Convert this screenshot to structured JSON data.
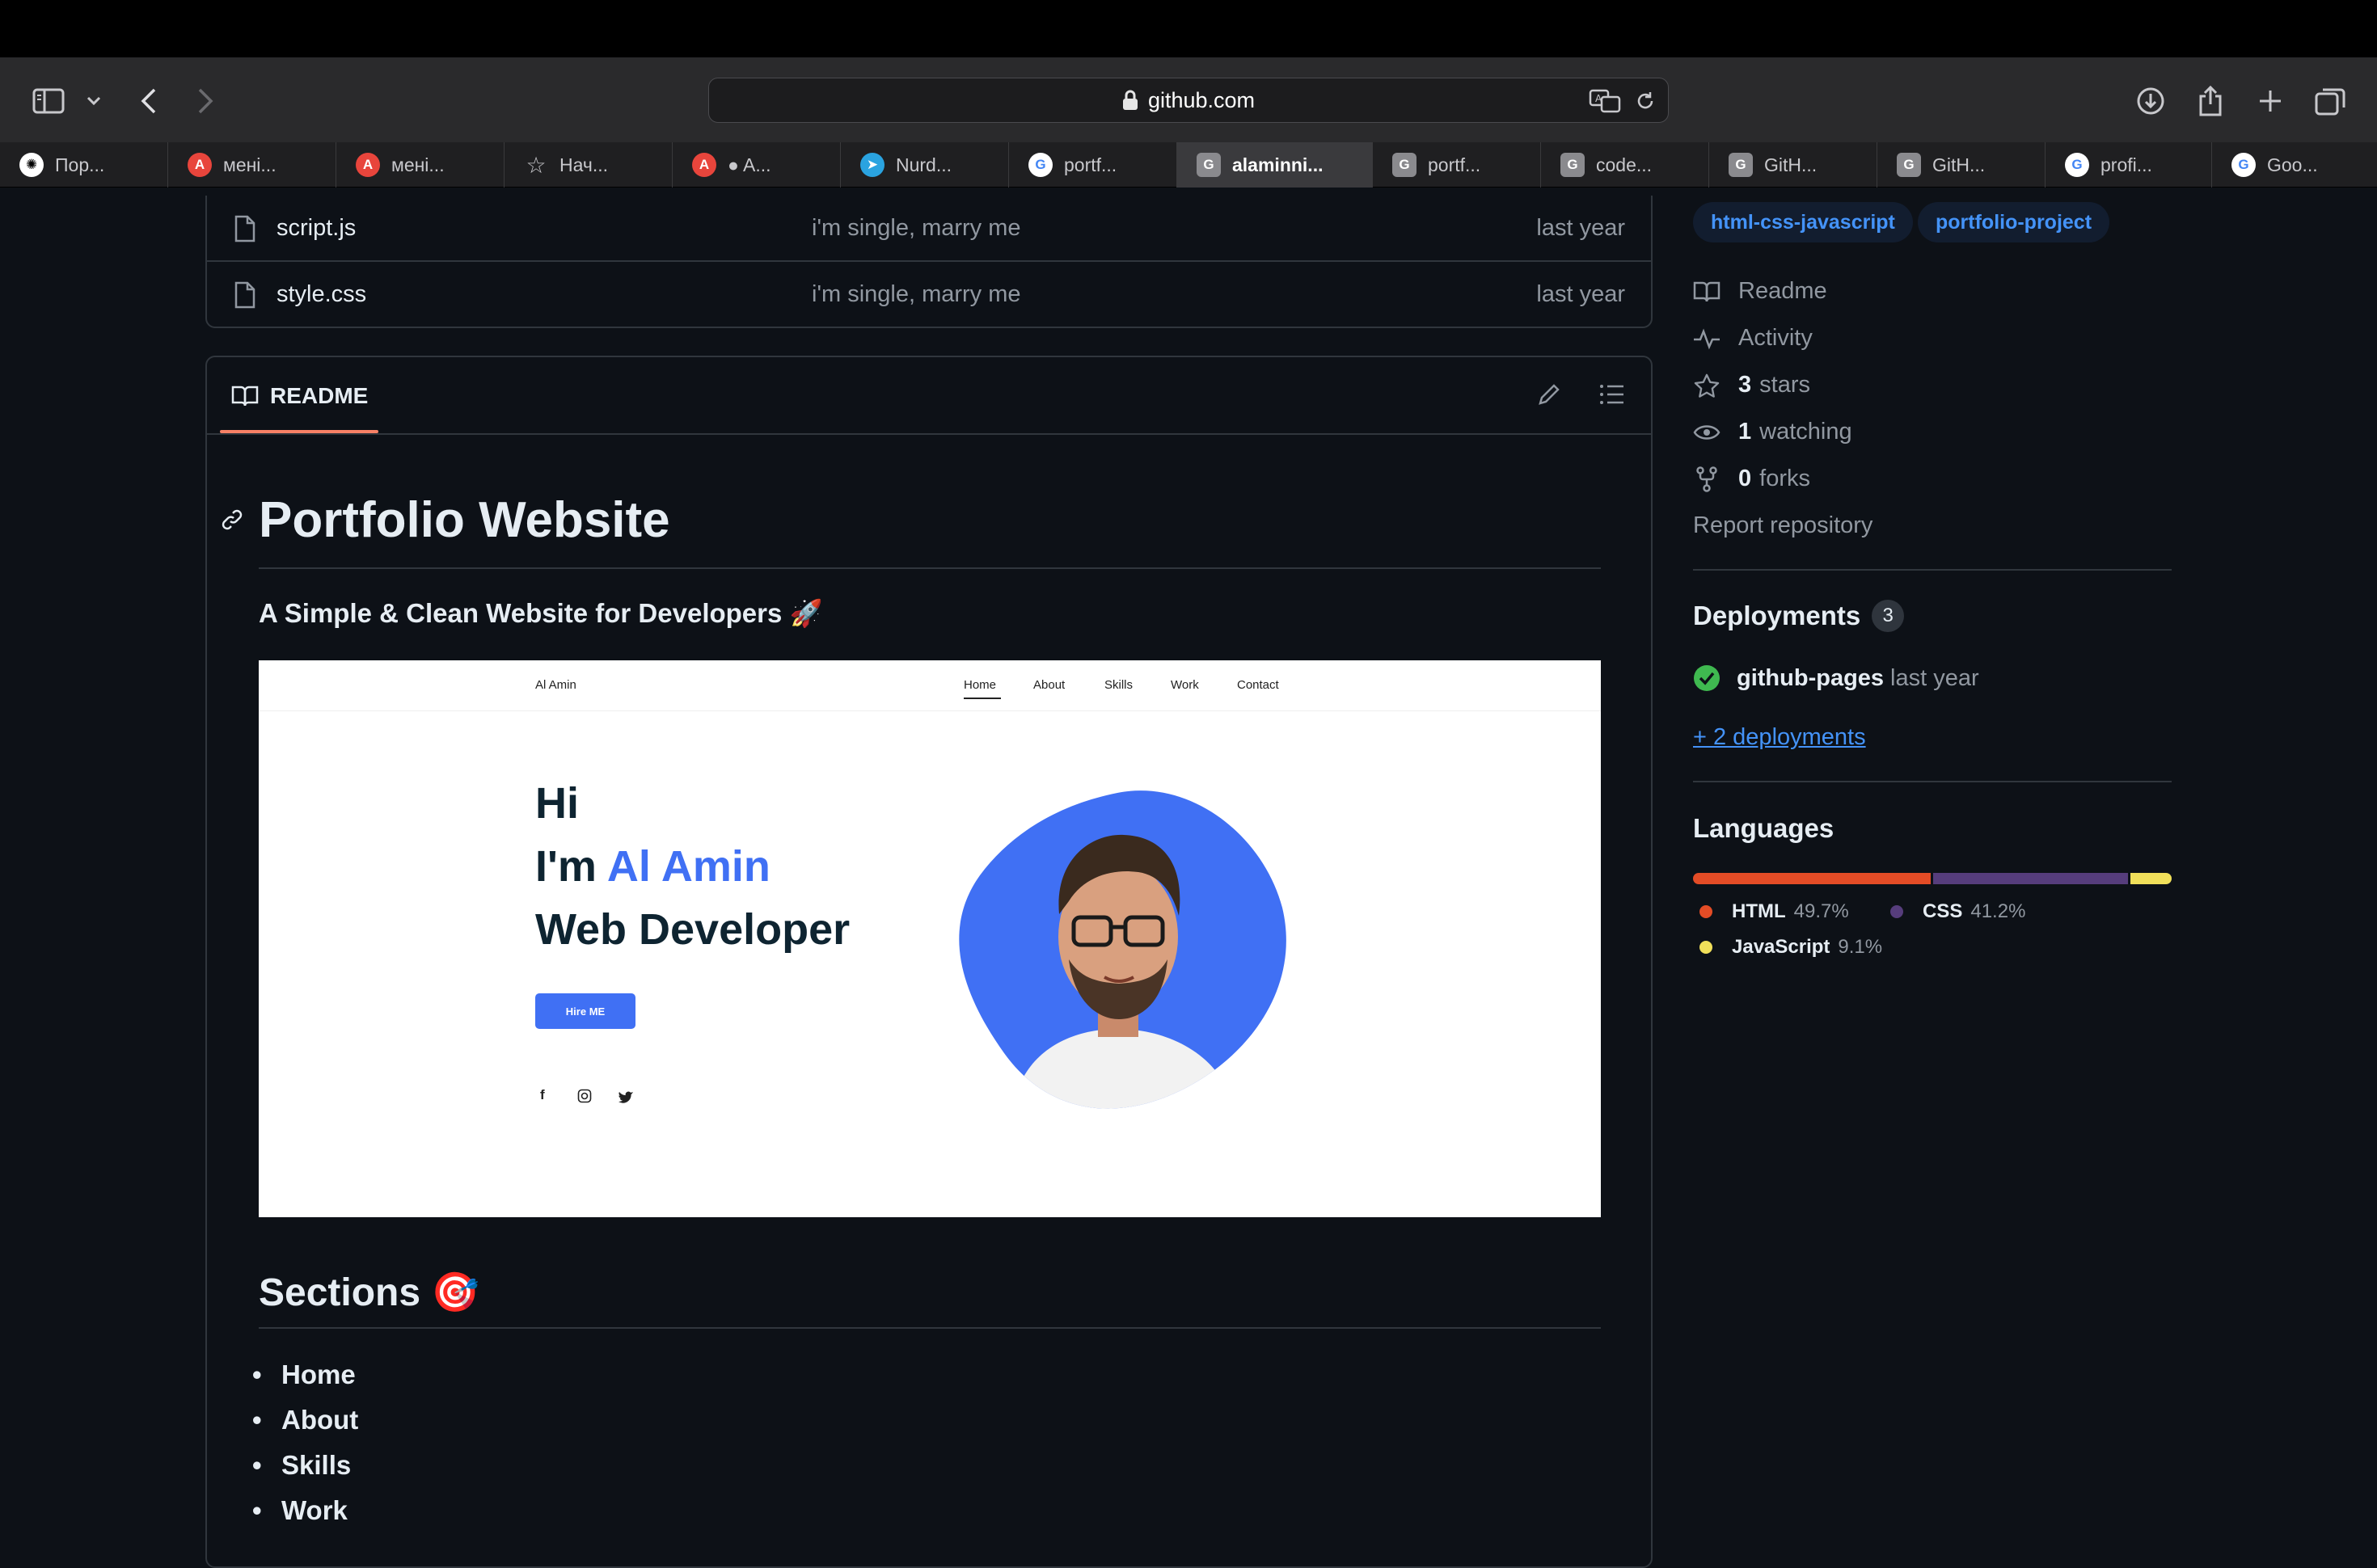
{
  "browser": {
    "url": "github.com",
    "tabs": [
      {
        "label": "Пор...",
        "icon": "openai-icon"
      },
      {
        "label": "мені...",
        "icon": "app-icon"
      },
      {
        "label": "мені...",
        "icon": "app-icon"
      },
      {
        "label": "Нач...",
        "icon": "star-icon"
      },
      {
        "label": "● A...",
        "icon": "app-icon"
      },
      {
        "label": "Nurd...",
        "icon": "telegram-icon"
      },
      {
        "label": "portf...",
        "icon": "google-icon"
      },
      {
        "label": "alaminni...",
        "icon": "g-icon",
        "active": true
      },
      {
        "label": "portf...",
        "icon": "g-icon"
      },
      {
        "label": "code...",
        "icon": "g-icon"
      },
      {
        "label": "GitH...",
        "icon": "g-icon"
      },
      {
        "label": "GitH...",
        "icon": "g-icon"
      },
      {
        "label": "profi...",
        "icon": "google-icon"
      },
      {
        "label": "Goo...",
        "icon": "google-icon"
      }
    ]
  },
  "files": [
    {
      "name": "script.js",
      "message": "i'm single, marry me",
      "date": "last year"
    },
    {
      "name": "style.css",
      "message": "i'm single, marry me",
      "date": "last year"
    }
  ],
  "readme": {
    "tab_label": "README",
    "title": "Portfolio Website",
    "subtitle": "A Simple & Clean Website for Developers 🚀",
    "sections_heading": "Sections 🎯",
    "sections": [
      "Home",
      "About",
      "Skills",
      "Work"
    ],
    "preview": {
      "logo": "Al Amin",
      "nav": [
        "Home",
        "About",
        "Skills",
        "Work",
        "Contact"
      ],
      "hi": "Hi",
      "im": "I'm",
      "name": "Al Amin",
      "role": "Web Developer",
      "button": "Hire ME",
      "accent": "#4070f4"
    }
  },
  "sidebar": {
    "topics": [
      "html-css-javascript",
      "portfolio-project"
    ],
    "links": [
      {
        "icon": "book-icon",
        "bold": "",
        "label": "Readme"
      },
      {
        "icon": "pulse-icon",
        "bold": "",
        "label": "Activity"
      },
      {
        "icon": "star-icon",
        "bold": "3",
        "label": "stars"
      },
      {
        "icon": "eye-icon",
        "bold": "1",
        "label": "watching"
      },
      {
        "icon": "fork-icon",
        "bold": "0",
        "label": "forks"
      }
    ],
    "report": "Report repository",
    "deployments": {
      "heading": "Deployments",
      "count": "3",
      "env": "github-pages",
      "when": "last year",
      "more": "+ 2 deployments"
    },
    "languages": {
      "heading": "Languages",
      "items": [
        {
          "name": "HTML",
          "percent": "49.7%",
          "value": 49.7,
          "color": "#e34c26"
        },
        {
          "name": "CSS",
          "percent": "41.2%",
          "value": 41.2,
          "color": "#563d7c"
        },
        {
          "name": "JavaScript",
          "percent": "9.1%",
          "value": 9.1,
          "color": "#f1e05a"
        }
      ]
    }
  }
}
